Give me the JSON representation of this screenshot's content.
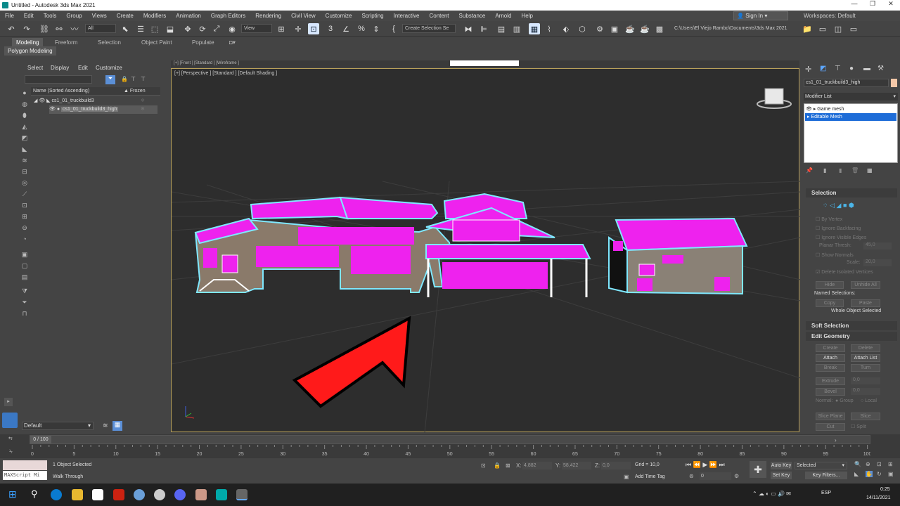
{
  "window": {
    "title": "Untitled - Autodesk 3ds Max 2021"
  },
  "menu": [
    "File",
    "Edit",
    "Tools",
    "Group",
    "Views",
    "Create",
    "Modifiers",
    "Animation",
    "Graph Editors",
    "Rendering",
    "Civil View",
    "Customize",
    "Scripting",
    "Interactive",
    "Content",
    "Substance",
    "Arnold",
    "Help"
  ],
  "signin": "Sign In",
  "workspaces": {
    "label": "Workspaces:",
    "value": "Default"
  },
  "toolbar": {
    "filter": "All",
    "view": "View",
    "selection_set": "Create Selection Se",
    "path": "C:\\Users\\El Viejo Rambo\\Documents\\3ds Max 2021"
  },
  "ribbon": {
    "tabs": [
      "Modeling",
      "Freeform",
      "Selection",
      "Object Paint",
      "Populate"
    ],
    "active_panel": "Polygon Modeling"
  },
  "scene_explorer": {
    "menu": [
      "Select",
      "Display",
      "Edit",
      "Customize"
    ],
    "columns": {
      "name": "Name (Sorted Ascending)",
      "frozen": "▲ Frozen"
    },
    "rows": [
      "cs1_01_truckbuild3",
      "cs1_01_truckbuild3_high"
    ],
    "layer": "Default"
  },
  "viewport": {
    "label": "[+] [Perspective ] [Standard ] [Default Shading ]",
    "top_label": "[+] [Front ] [Standard ] [Wireframe ]"
  },
  "command_panel": {
    "object_name": "cs1_01_truckbuild3_high",
    "modifier_list": "Modifier List",
    "stack": [
      "Game mesh",
      "Editable Mesh"
    ],
    "selection": {
      "title": "Selection",
      "options": [
        "By Vertex",
        "Ignore Backfacing",
        "Ignore Visible Edges"
      ],
      "planar_thresh": {
        "label": "Planar Thresh:",
        "value": "45,0"
      },
      "show_normals": "Show Normals",
      "scale": {
        "label": "Scale:",
        "value": "20,0"
      },
      "delete_isolated": "Delete Isolated Vertices",
      "hide": "Hide",
      "unhide_all": "Unhide All",
      "named_selections": "Named Selections:",
      "copy": "Copy",
      "paste": "Paste",
      "whole_object": "Whole Object Selected"
    },
    "soft_selection": "Soft Selection",
    "edit_geometry": {
      "title": "Edit Geometry",
      "buttons": [
        "Create",
        "Delete",
        "Attach",
        "Attach List",
        "Break",
        "Turn"
      ],
      "extrude": {
        "label": "Extrude",
        "value": "0,0"
      },
      "bevel": {
        "label": "Bevel",
        "value": "0,0"
      },
      "normal": {
        "label": "Normal:",
        "group": "Group",
        "local": "Local"
      },
      "slice_plane": "Slice Plane",
      "slice": "Slice",
      "cut": "Cut",
      "split": "Split"
    }
  },
  "timeline": {
    "frame": "0 / 100",
    "ticks": [
      "0",
      "5",
      "10",
      "15",
      "20",
      "25",
      "30",
      "35",
      "40",
      "45",
      "50",
      "55",
      "60",
      "65",
      "70",
      "75",
      "80",
      "85",
      "90",
      "95",
      "100"
    ]
  },
  "status": {
    "maxscript": "MAXScript Mi",
    "selected": "1 Object Selected",
    "walk": "Walk Through",
    "x": {
      "label": "X:",
      "value": "4,882"
    },
    "y": {
      "label": "Y:",
      "value": "58,422"
    },
    "z": {
      "label": "Z:",
      "value": "0,0"
    },
    "grid": "Grid = 10,0",
    "add_time_tag": "Add Time Tag",
    "auto_key": "Auto Key",
    "set_key": "Set Key",
    "selected_dd": "Selected",
    "key_filters": "Key Filters...",
    "frame_value": "0"
  },
  "taskbar": {
    "lang": "ESP",
    "time": "0:25",
    "date": "14/11/2021"
  },
  "colors": {
    "accent": "#1e6dd8",
    "selection_magenta": "#ee22ee",
    "wire_cyan": "#7fe8ff",
    "arrow_red": "#ff1a1a"
  }
}
